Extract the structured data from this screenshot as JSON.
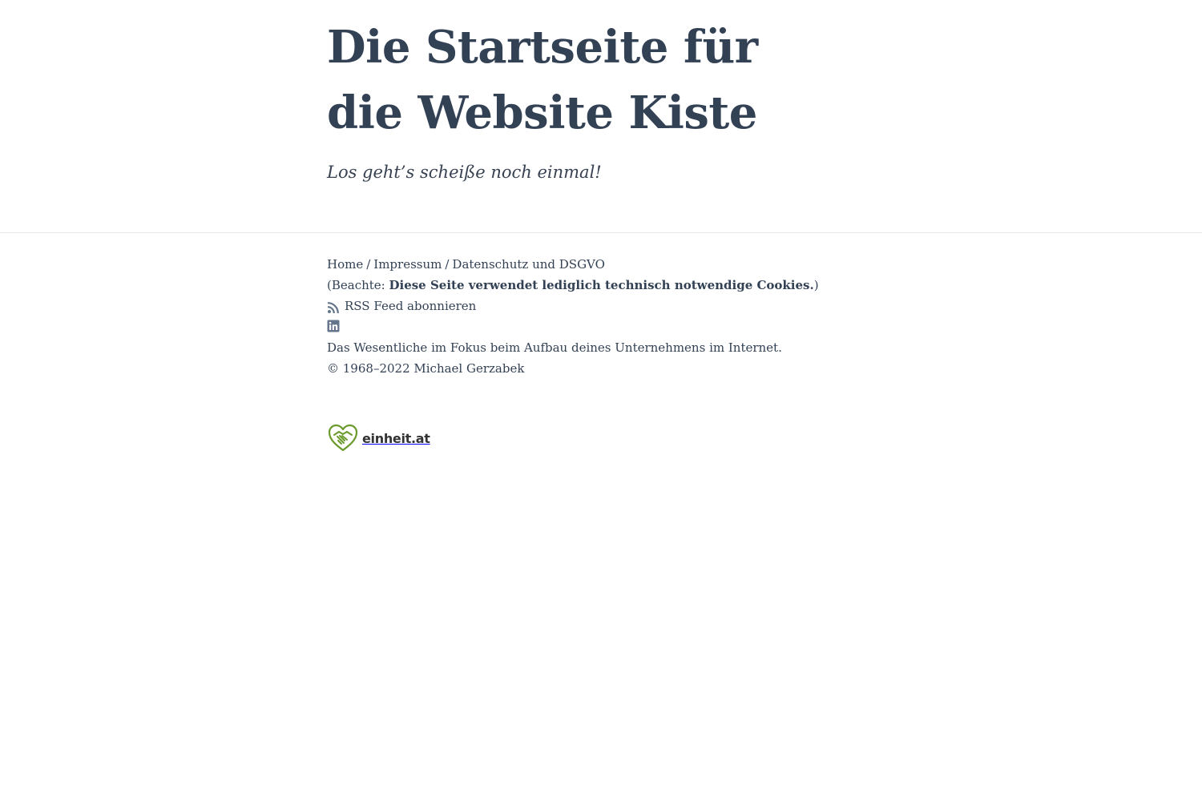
{
  "header": {
    "title": "Die Startseite für die Website Kiste",
    "tagline": "Los geht’s scheiße noch einmal!"
  },
  "footer": {
    "nav": {
      "home": "Home",
      "imprint": "Impressum",
      "privacy": "Datenschutz und DSGVO",
      "separator": "/"
    },
    "cookie_note": {
      "prefix": "(Beachte: ",
      "bold": "Diese Seite verwendet lediglich technisch notwendige Cookies.",
      "suffix": ")"
    },
    "rss": {
      "label": "RSS Feed abonnieren",
      "icon": "rss-icon"
    },
    "social": {
      "icon": "linkedin-icon"
    },
    "description": "Das Wesentliche im Fokus beim Aufbau deines Unternehmens im Internet.",
    "copyright": "© 1968–2022 Michael Gerzabek"
  },
  "logo": {
    "text": "einheit.at",
    "icon": "handshake-heart-icon",
    "color": "#6a9a2b"
  },
  "colors": {
    "text": "#334155",
    "divider": "#e5e7eb",
    "icon": "#64748b"
  }
}
